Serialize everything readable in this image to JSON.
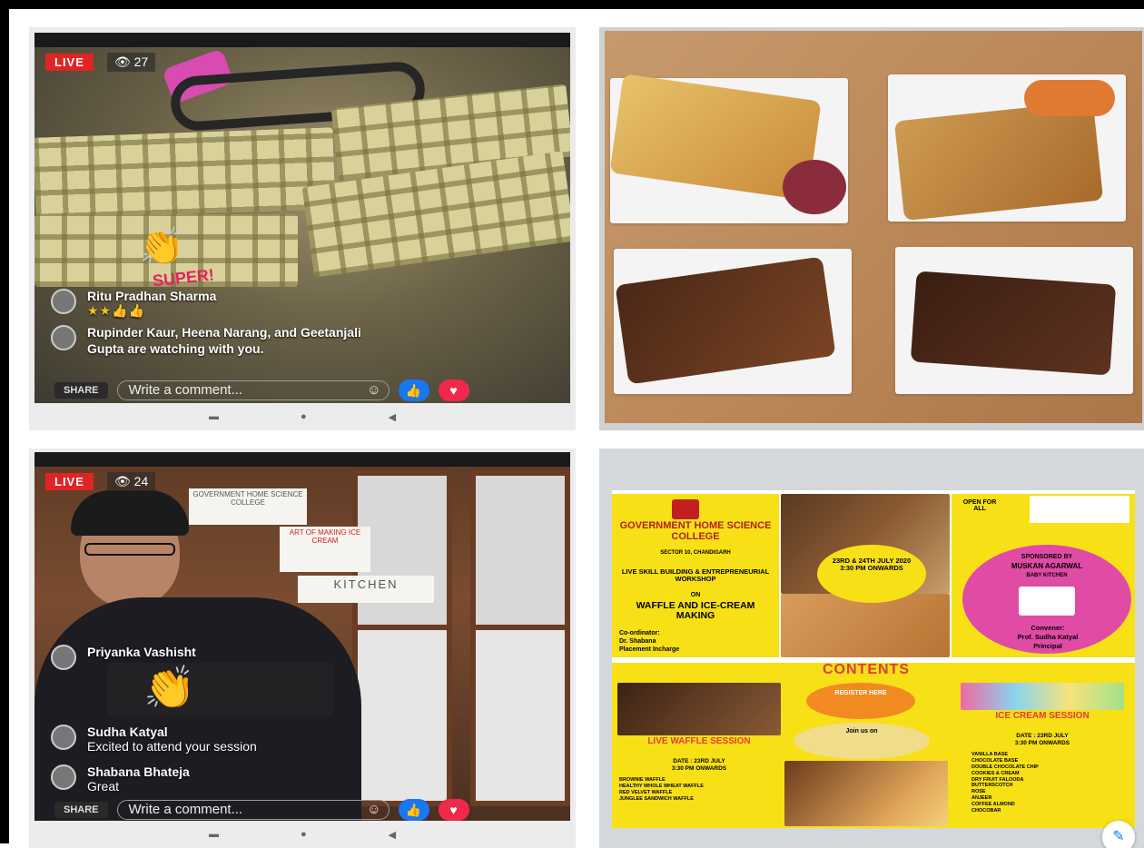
{
  "panel1": {
    "live_label": "LIVE",
    "viewer_count": "27",
    "reaction_text": "SUPER!",
    "comments": [
      {
        "name": "Ritu Pradhan Sharma",
        "text": "★★👍👍"
      },
      {
        "name": "",
        "text": "Rupinder Kaur, Heena Narang, and Geetanjali Gupta are watching with you."
      }
    ],
    "share_label": "SHARE",
    "comment_placeholder": "Write a comment..."
  },
  "panel3": {
    "live_label": "LIVE",
    "viewer_count": "24",
    "notice_1": "GOVERNMENT HOME SCIENCE COLLEGE",
    "notice_2": "ART OF MAKING ICE CREAM",
    "notice_3": "KITCHEN",
    "comments": [
      {
        "name": "Priyanka Vashisht",
        "text": ""
      },
      {
        "name": "Sudha Katyal",
        "text": "Excited to attend your session"
      },
      {
        "name": "Shabana Bhateja",
        "text": "Great"
      }
    ],
    "share_label": "SHARE",
    "comment_placeholder": "Write a comment..."
  },
  "poster": {
    "college": "GOVERNMENT HOME SCIENCE COLLEGE",
    "college_sub": "SECTOR 10, CHANDIGARH",
    "workshop": "LIVE SKILL BUILDING & ENTREPRENEURIAL WORKSHOP",
    "on": "ON",
    "topic": "WAFFLE AND ICE-CREAM MAKING",
    "coordinator_label": "Co-ordinator:",
    "coordinator_name": "Dr. Shabana",
    "coordinator_role": "Placement Incharge",
    "dates": "23RD & 24TH JULY 2020 3:30 PM ONWARDS",
    "open_for_all": "OPEN FOR ALL",
    "sponsored_label": "SPONSORED BY",
    "sponsor_name": "MUSKAN AGARWAL",
    "sponsor_org": "BABY KITCHEN",
    "convener_label": "Convener:",
    "convener_name": "Prof. Sudha Katyal",
    "convener_role": "Principal",
    "contents": "CONTENTS",
    "register": "REGISTER HERE",
    "join": "Join us on",
    "waffle_title": "LIVE WAFFLE SESSION",
    "waffle_date": "DATE : 23RD JULY",
    "waffle_time": "3:30 PM ONWARDS",
    "waffle_items": [
      "BROWNIE WAFFLE",
      "HEALTHY WHOLE WHEAT WAFFLE",
      "RED VELVET WAFFLE",
      "JUNGLEE SANDWICH WAFFLE"
    ],
    "ice_title": "ICE CREAM SESSION",
    "ice_date": "DATE : 23RD JULY",
    "ice_time": "3:30 PM ONWARDS",
    "ice_items": [
      "VANILLA BASE",
      "CHOCOLATE BASE",
      "DOUBLE CHOCOLATE CHIP",
      "COOKIES & CREAM",
      "DRY FRUIT FALOODA",
      "BUTTERSCOTCH",
      "ROSE",
      "ANJEER",
      "COFFEE ALMOND",
      "CHOCOBAR"
    ]
  },
  "colors": {
    "live_red": "#e02424",
    "poster_yellow": "#f8e016",
    "poster_pink": "#e04ba6",
    "poster_red": "#e33a3a",
    "like_blue": "#1877f2"
  }
}
